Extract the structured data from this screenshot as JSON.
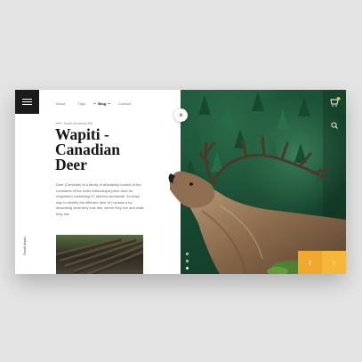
{
  "nav": {
    "items": [
      {
        "label": "About",
        "active": false
      },
      {
        "label": "Trips",
        "active": false
      },
      {
        "label": "Blog",
        "active": true
      },
      {
        "label": "Contact",
        "active": false
      }
    ]
  },
  "article": {
    "eyebrow": "North America Elk",
    "title_line1": "Wapiti -",
    "title_line2": "Canadian",
    "title_line3": "Deer",
    "body": "Deer (Cervidae) is a family of artiodactyl hoofed of the ruminants of the order Artiodactyla (deer-toed for ungulates) containing 47 species worldwide. An easy way to identify the different deer of Canada is by describing what they look like, where they live and what they eat."
  },
  "side_label": "Scroll down",
  "close_glyph": "×",
  "arrows": {
    "prev": "‹",
    "next": "›"
  },
  "slider": {
    "count": 3,
    "active_index": 2
  },
  "colors": {
    "accent": "#f5b63c",
    "dark": "#1b1b1b",
    "forest": "#174a32",
    "notification": "#f5b63c"
  },
  "icons": {
    "menu": "hamburger-icon",
    "cart": "cart-icon",
    "search": "search-icon"
  }
}
